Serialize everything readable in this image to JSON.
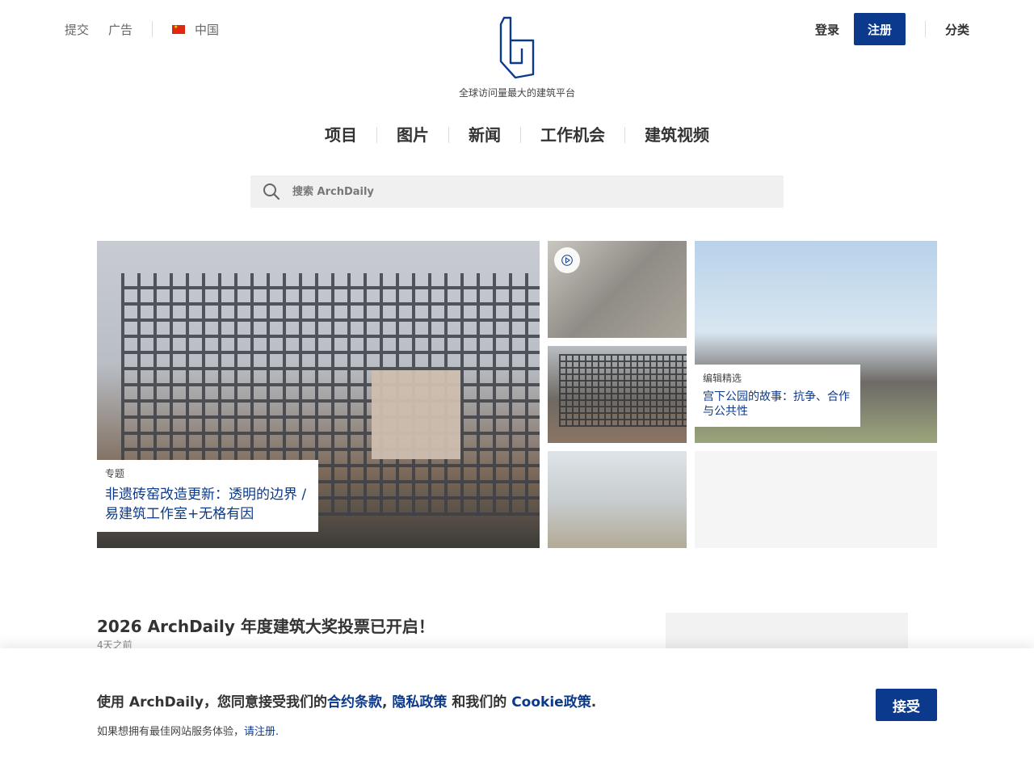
{
  "header": {
    "submit_label": "提交",
    "ads_label": "广告",
    "region_label": "中国",
    "tagline": "全球访问量最大的建筑平台",
    "login_label": "登录",
    "register_label": "注册",
    "categories_label": "分类"
  },
  "nav": {
    "items": [
      "项目",
      "图片",
      "新闻",
      "工作机会",
      "建筑视频"
    ]
  },
  "search": {
    "placeholder": "搜索 ArchDaily"
  },
  "features": {
    "main": {
      "category": "专题",
      "title": "非遗砖窑改造更新：透明的边界 / 易建筑工作室+无格有因"
    },
    "right": {
      "category": "编辑精选",
      "title": "宫下公园的故事：抗争、合作与公共性"
    }
  },
  "article": {
    "title": "2026 ArchDaily 年度建筑大奖投票已开启！",
    "time": "4天之前"
  },
  "cookie": {
    "prefix": "使用 ArchDaily，您同意接受我们的",
    "terms": "合约条款",
    "comma": ",",
    "privacy": "隐私政策",
    "and_our": " 和我们的 ",
    "cookie_policy": "Cookie政策",
    "period": ".",
    "line2_prefix": "如果想拥有最佳网站服务体验，",
    "register_link": "请注册.",
    "accept_label": "接受"
  },
  "colors": {
    "brand": "#0b3a8c",
    "text": "#333333"
  }
}
